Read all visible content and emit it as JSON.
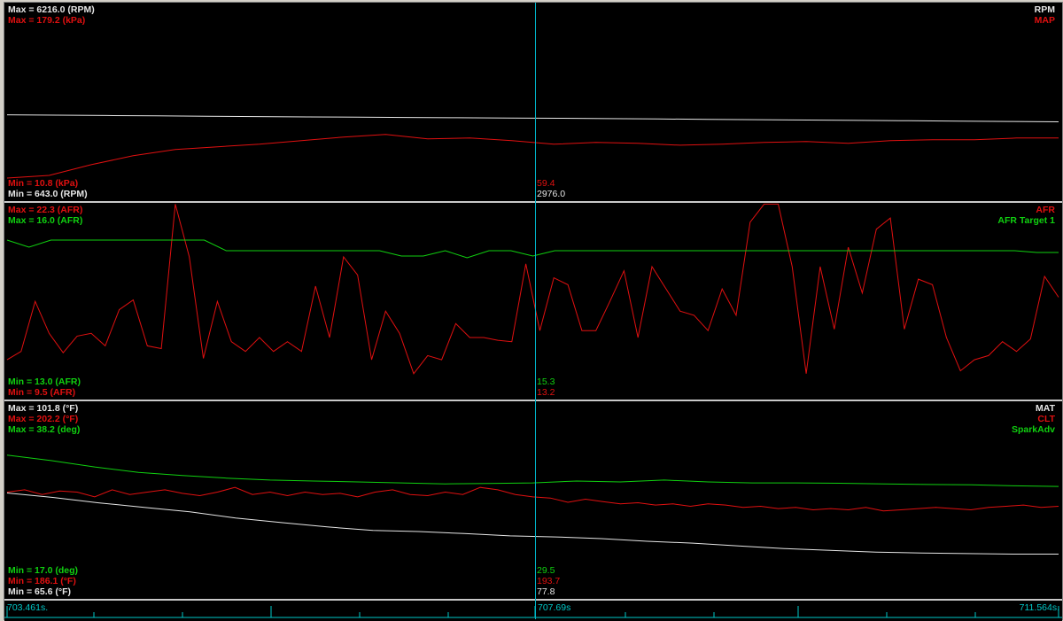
{
  "colors": {
    "white": "#e6e6e6",
    "red": "#e01010",
    "green": "#10d010",
    "cyan": "#00c8c8"
  },
  "panels": [
    {
      "labels_top_left": [
        {
          "text": "Max = 6216.0 (RPM)",
          "color": "white"
        },
        {
          "text": "Max = 179.2 (kPa)",
          "color": "red"
        }
      ],
      "labels_top_right": [
        {
          "text": "RPM",
          "color": "white"
        },
        {
          "text": "MAP",
          "color": "red"
        }
      ],
      "labels_bottom_left": [
        {
          "text": "Min = 10.8 (kPa)",
          "color": "red"
        },
        {
          "text": "Min = 643.0 (RPM)",
          "color": "white"
        }
      ],
      "cursor_values": [
        {
          "text": "59.4",
          "color": "red"
        },
        {
          "text": "2976.0",
          "color": "white"
        }
      ]
    },
    {
      "labels_top_left": [
        {
          "text": "Max = 22.3 (AFR)",
          "color": "red"
        },
        {
          "text": "Max = 16.0 (AFR)",
          "color": "green"
        }
      ],
      "labels_top_right": [
        {
          "text": "AFR",
          "color": "red"
        },
        {
          "text": "AFR Target 1",
          "color": "green"
        }
      ],
      "labels_bottom_left": [
        {
          "text": "Min = 13.0 (AFR)",
          "color": "green"
        },
        {
          "text": "Min = 9.5 (AFR)",
          "color": "red"
        }
      ],
      "cursor_values": [
        {
          "text": "15.3",
          "color": "green"
        },
        {
          "text": "13.2",
          "color": "red"
        }
      ]
    },
    {
      "labels_top_left": [
        {
          "text": "Max = 101.8 (°F)",
          "color": "white"
        },
        {
          "text": "Max = 202.2 (°F)",
          "color": "red"
        },
        {
          "text": "Max = 38.2 (deg)",
          "color": "green"
        }
      ],
      "labels_top_right": [
        {
          "text": "MAT",
          "color": "white"
        },
        {
          "text": "CLT",
          "color": "red"
        },
        {
          "text": "SparkAdv",
          "color": "green"
        }
      ],
      "labels_bottom_left": [
        {
          "text": "Min = 17.0 (deg)",
          "color": "green"
        },
        {
          "text": "Min = 186.1 (°F)",
          "color": "red"
        },
        {
          "text": "Min = 65.6 (°F)",
          "color": "white"
        }
      ],
      "cursor_values": [
        {
          "text": "29.5",
          "color": "green"
        },
        {
          "text": "193.7",
          "color": "red"
        },
        {
          "text": "77.8",
          "color": "white"
        }
      ]
    }
  ],
  "time_axis": {
    "start_label": "703.461s.",
    "cursor_label": "707.69s",
    "end_label": "711.564s."
  },
  "chart_data": {
    "type": "line",
    "x_range": [
      703.461,
      711.564
    ],
    "cursor_time": 707.69,
    "panels": [
      {
        "series": [
          {
            "name": "RPM",
            "color": "white",
            "ylim": [
              600,
              6216
            ],
            "values": [
              3062,
              3050,
              3040,
              3030,
              3020,
              3010,
              3000,
              2995,
              2985,
              2976,
              2968,
              2960,
              2950,
              2940,
              2930,
              2920,
              2910,
              2900,
              2890,
              2880,
              2870,
              2860
            ]
          },
          {
            "name": "MAP",
            "color": "red",
            "ylim": [
              -21,
              259
            ],
            "values": [
              10.8,
              14.6,
              30,
              42.9,
              51.8,
              55.7,
              59.4,
              64.6,
              69.7,
              73.6,
              67.2,
              68.4,
              64.6,
              59.4,
              62,
              60.7,
              58.1,
              59.4,
              62,
              63.3,
              60.7,
              64.6,
              65.9,
              65.9,
              68.4,
              68.4
            ]
          }
        ]
      },
      {
        "series": [
          {
            "name": "AFR",
            "color": "red",
            "ylim": [
              8.3,
              22.2
            ],
            "values": [
              11.1,
              11.7,
              15.3,
              13.0,
              11.6,
              12.8,
              13.0,
              12.1,
              14.7,
              15.4,
              12.1,
              11.9,
              22.3,
              18.5,
              11.2,
              15.3,
              12.4,
              11.7,
              12.7,
              11.7,
              12.4,
              11.7,
              16.4,
              12.7,
              18.5,
              17.2,
              11.1,
              14.6,
              13.0,
              10.1,
              11.4,
              11.1,
              13.7,
              12.7,
              12.7,
              12.5,
              12.4,
              18.0,
              13.2,
              17.0,
              16.5,
              13.2,
              13.2,
              15.3,
              17.5,
              12.7,
              17.8,
              16.2,
              14.6,
              14.3,
              13.2,
              16.2,
              14.3,
              21.0,
              22.3,
              22.3,
              17.8,
              10.1,
              17.8,
              13.3,
              19.2,
              15.9,
              20.5,
              21.3,
              13.3,
              16.9,
              16.5,
              12.7,
              10.3,
              11.1,
              11.4,
              12.4,
              11.7,
              12.6,
              17.1,
              15.6
            ]
          },
          {
            "name": "AFR Target 1",
            "color": "green",
            "ylim": [
              7.05,
              17.95
            ],
            "values": [
              16,
              15.6,
              16,
              16,
              16,
              16,
              16,
              16,
              16,
              16,
              15.4,
              15.4,
              15.4,
              15.4,
              15.4,
              15.4,
              15.4,
              15.4,
              15.1,
              15.1,
              15.4,
              15.0,
              15.4,
              15.4,
              15.1,
              15.4,
              15.4,
              15.4,
              15.4,
              15.4,
              15.4,
              15.4,
              15.4,
              15.4,
              15.4,
              15.4,
              15.4,
              15.4,
              15.4,
              15.4,
              15.4,
              15.4,
              15.4,
              15.4,
              15.4,
              15.4,
              15.4,
              15.3,
              15.3
            ]
          }
        ]
      },
      {
        "series": [
          {
            "name": "MAT",
            "color": "white",
            "ylim": [
              39.6,
              154.6
            ],
            "values": [
              101.8,
              99.2,
              96,
              93.3,
              90.7,
              87,
              84.3,
              81.7,
              79.6,
              79.0,
              77.8,
              76.4,
              75.8,
              74.8,
              73.2,
              72.1,
              70.5,
              68.9,
              67.8,
              66.8,
              66.2,
              65.9,
              65.6,
              65.6
            ]
          },
          {
            "name": "CLT",
            "color": "red",
            "ylim": [
              153,
              235.5
            ],
            "values": [
              198,
              199,
              197,
              198.5,
              198,
              196,
              199,
              197,
              198,
              199,
              197.5,
              196.5,
              198,
              200,
              197,
              198,
              196.5,
              198,
              197,
              197.5,
              196,
              198,
              199,
              197,
              196.5,
              198,
              197,
              200,
              199,
              197,
              196,
              195.5,
              193.7,
              195,
              194,
              193,
              193.5,
              192.5,
              193,
              192,
              193,
              192.5,
              191.5,
              192,
              191,
              191.5,
              190.5,
              191,
              190.5,
              191.5,
              190,
              190.5,
              191,
              191.5,
              191,
              190.5,
              191.5,
              192,
              192.5,
              191.5,
              192
            ]
          },
          {
            "name": "SparkAdv",
            "color": "green",
            "ylim": [
              -6.5,
              54.2
            ],
            "values": [
              38.2,
              36.5,
              34.5,
              32.8,
              31.8,
              31,
              30.4,
              30.1,
              29.8,
              29.5,
              29.2,
              29.3,
              29.5,
              30.1,
              29.8,
              30.4,
              29.8,
              29.5,
              29.5,
              29.4,
              29.2,
              29.0,
              28.9,
              28.6,
              28.4
            ]
          }
        ]
      }
    ]
  }
}
